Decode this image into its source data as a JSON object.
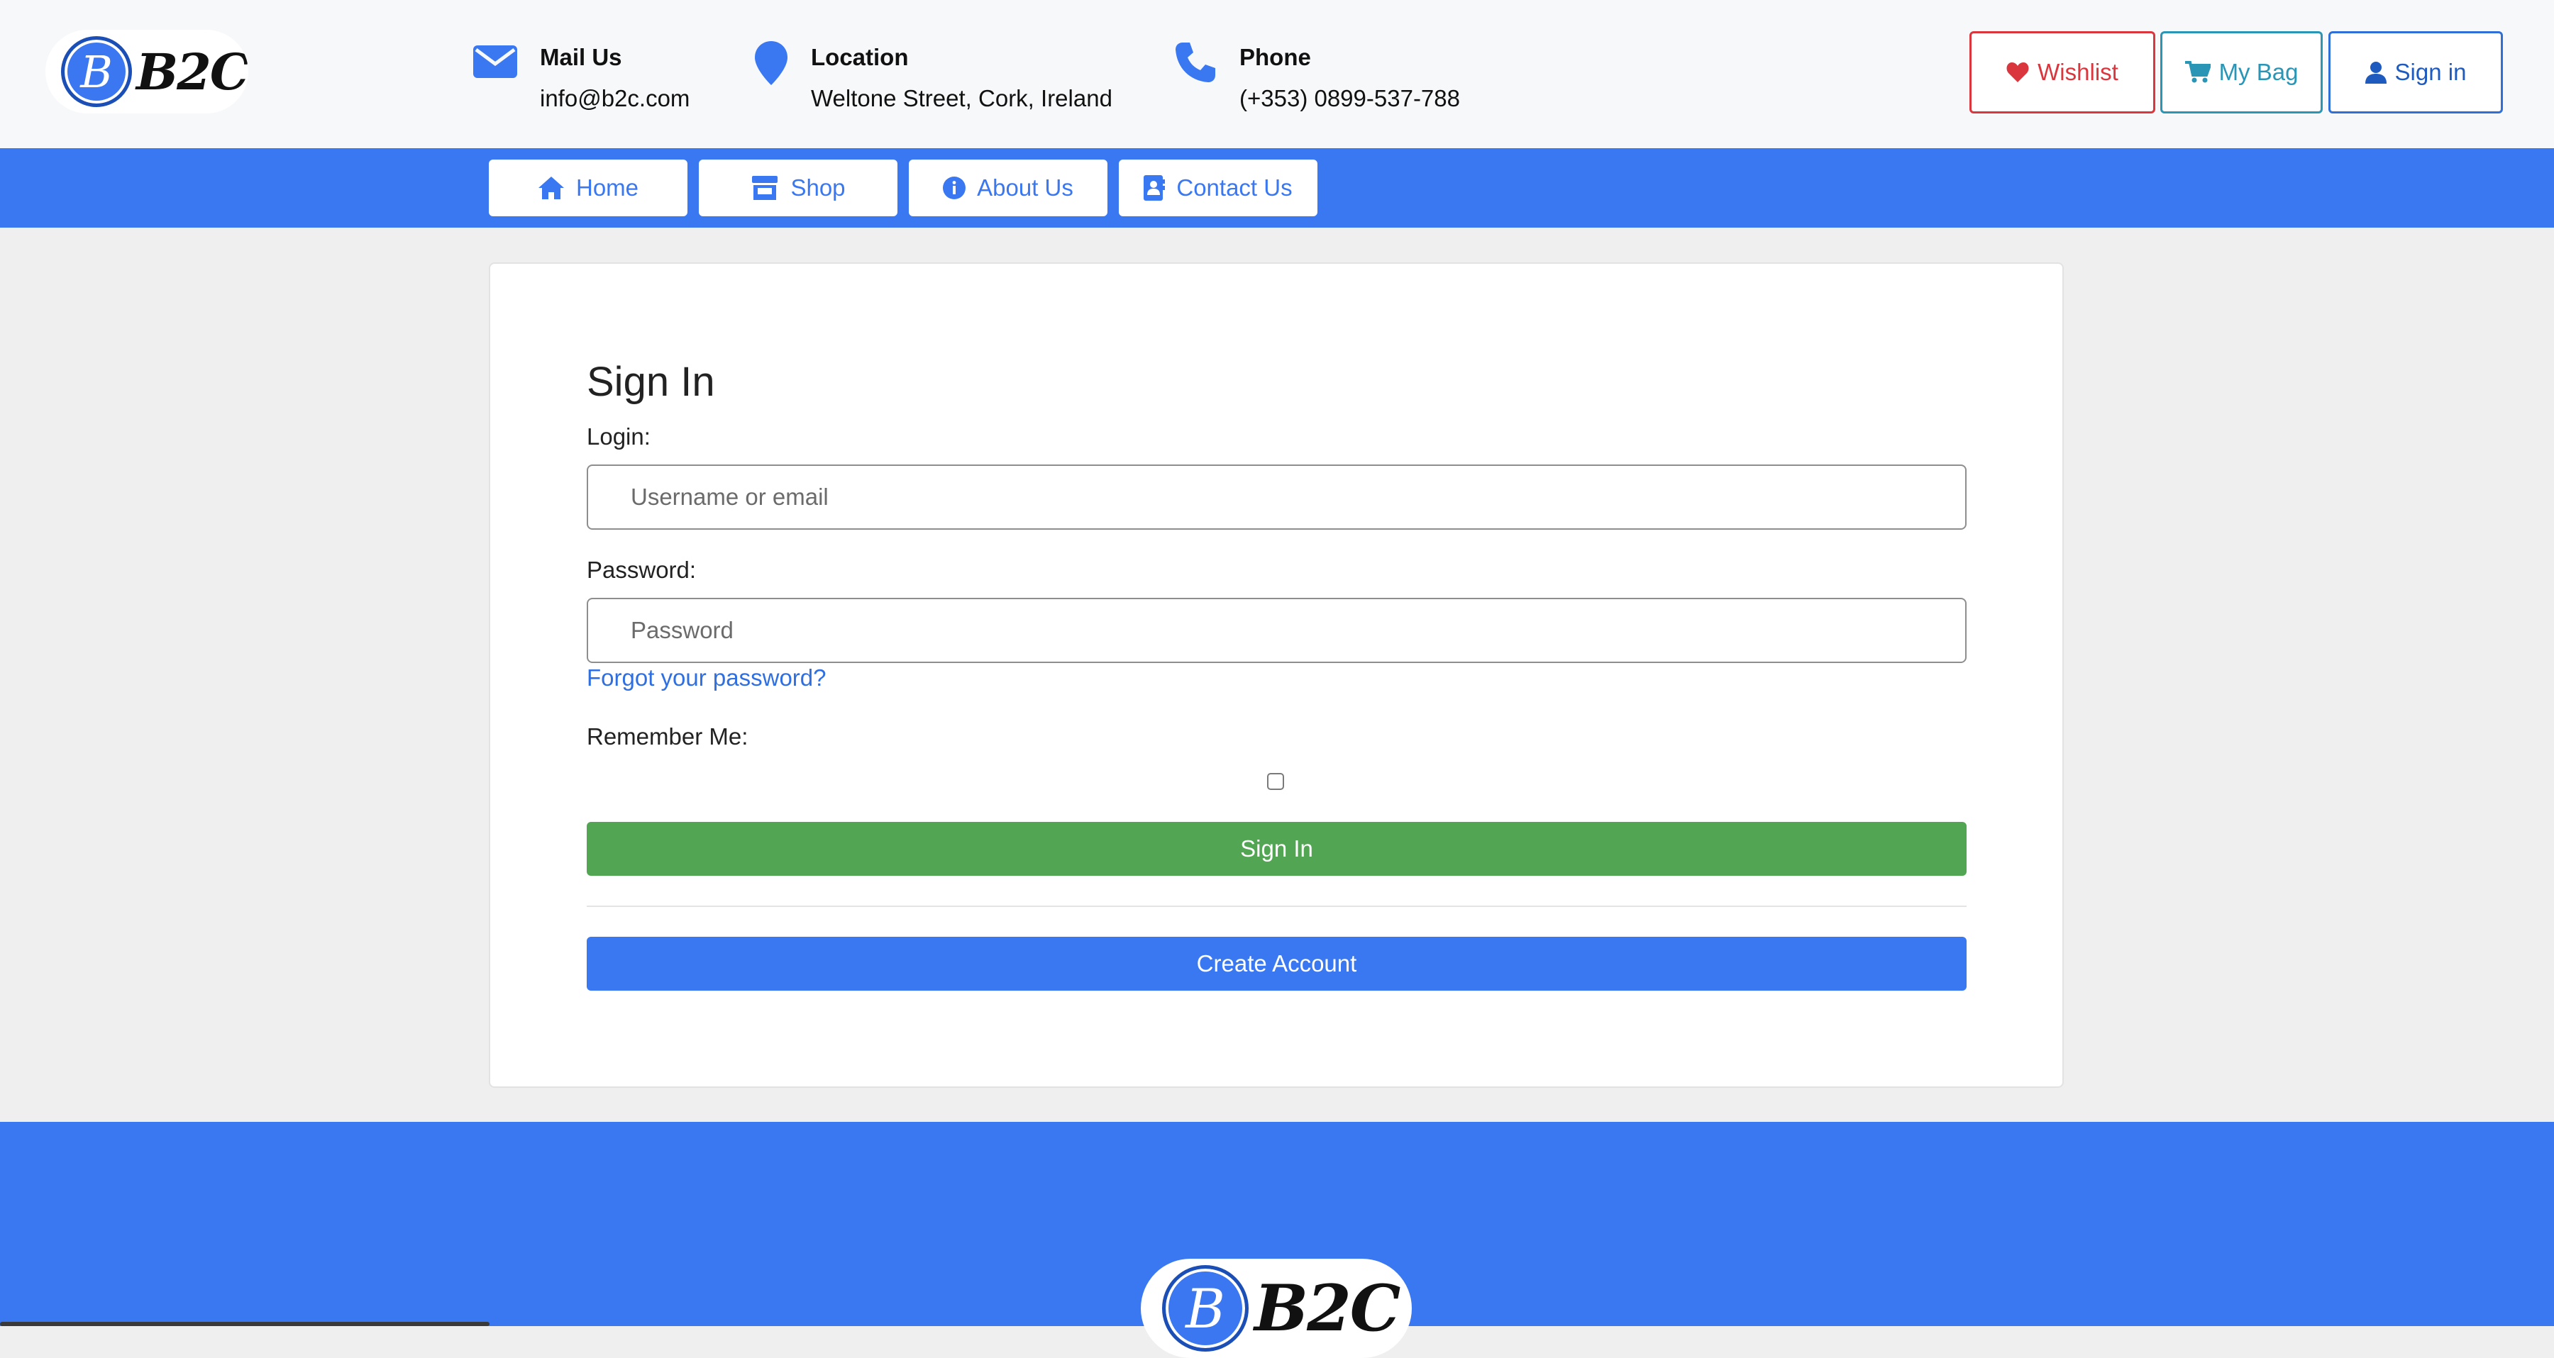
{
  "brand": {
    "logo_letter": "B",
    "logo_text": "B2C"
  },
  "contact": {
    "mail": {
      "icon": "envelope-icon",
      "title": "Mail Us",
      "value": "info@b2c.com"
    },
    "location": {
      "icon": "map-pin-icon",
      "title": "Location",
      "value": "Weltone Street, Cork, Ireland"
    },
    "phone": {
      "icon": "phone-icon",
      "title": "Phone",
      "value": "(+353) 0899-537-788"
    }
  },
  "header_buttons": {
    "wishlist": {
      "icon": "heart-icon",
      "label": "Wishlist",
      "color": "#d9363e"
    },
    "bag": {
      "icon": "cart-icon",
      "label": "My Bag",
      "color": "#2a95b5"
    },
    "signin": {
      "icon": "user-icon",
      "label": "Sign in",
      "color": "#1f5bbf"
    }
  },
  "nav": {
    "items": [
      {
        "icon": "home-icon",
        "label": "Home"
      },
      {
        "icon": "store-icon",
        "label": "Shop"
      },
      {
        "icon": "info-icon",
        "label": "About Us"
      },
      {
        "icon": "contact-card-icon",
        "label": "Contact Us"
      }
    ]
  },
  "form": {
    "title": "Sign In",
    "login_label": "Login:",
    "login_placeholder": "Username or email",
    "password_label": "Password:",
    "password_placeholder": "Password",
    "forgot_link": "Forgot your password?",
    "remember_label": "Remember Me:",
    "remember_checked": false,
    "submit_label": "Sign In",
    "create_label": "Create Account"
  },
  "colors": {
    "primary": "#3a78f2",
    "success": "#52a552",
    "danger": "#d9363e",
    "info": "#2a95b5"
  }
}
